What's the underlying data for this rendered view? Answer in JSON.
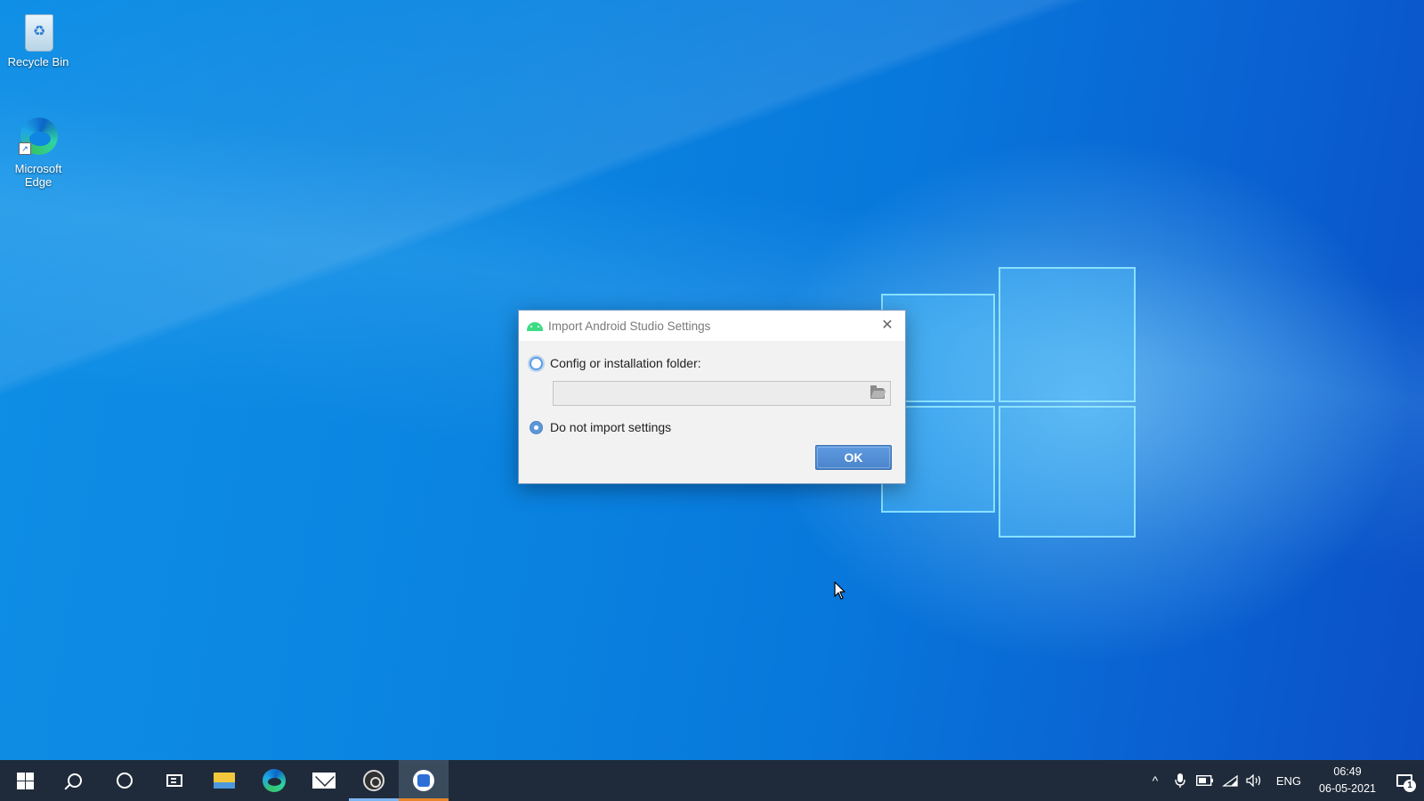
{
  "desktop": {
    "icons": [
      {
        "label": "Recycle Bin",
        "icon": "recycle-bin-icon"
      },
      {
        "label": "Microsoft Edge",
        "icon": "edge-icon"
      }
    ]
  },
  "dialog": {
    "title": "Import Android Studio Settings",
    "title_icon": "android-icon",
    "close_glyph": "✕",
    "option_config_label": "Config or installation folder:",
    "option_config_selected": false,
    "path_value": "",
    "path_placeholder": "",
    "option_no_import_label": "Do not import settings",
    "option_no_import_selected": true,
    "ok_label": "OK"
  },
  "taskbar": {
    "apps": [
      "start-icon",
      "search-icon",
      "cortana-icon",
      "task-view-icon",
      "file-explorer-icon",
      "edge-icon",
      "mail-icon",
      "obs-icon",
      "android-studio-icon"
    ],
    "tray": {
      "language": "ENG",
      "time": "06:49",
      "date": "06-05-2021",
      "notification_count": "1"
    }
  },
  "colors": {
    "desktop_blue": "#0a84e0",
    "taskbar": "#1f2b3a",
    "accent_button": "#4a84cc",
    "android_green": "#3ddc84",
    "active_app_underline": "#e6852b"
  }
}
